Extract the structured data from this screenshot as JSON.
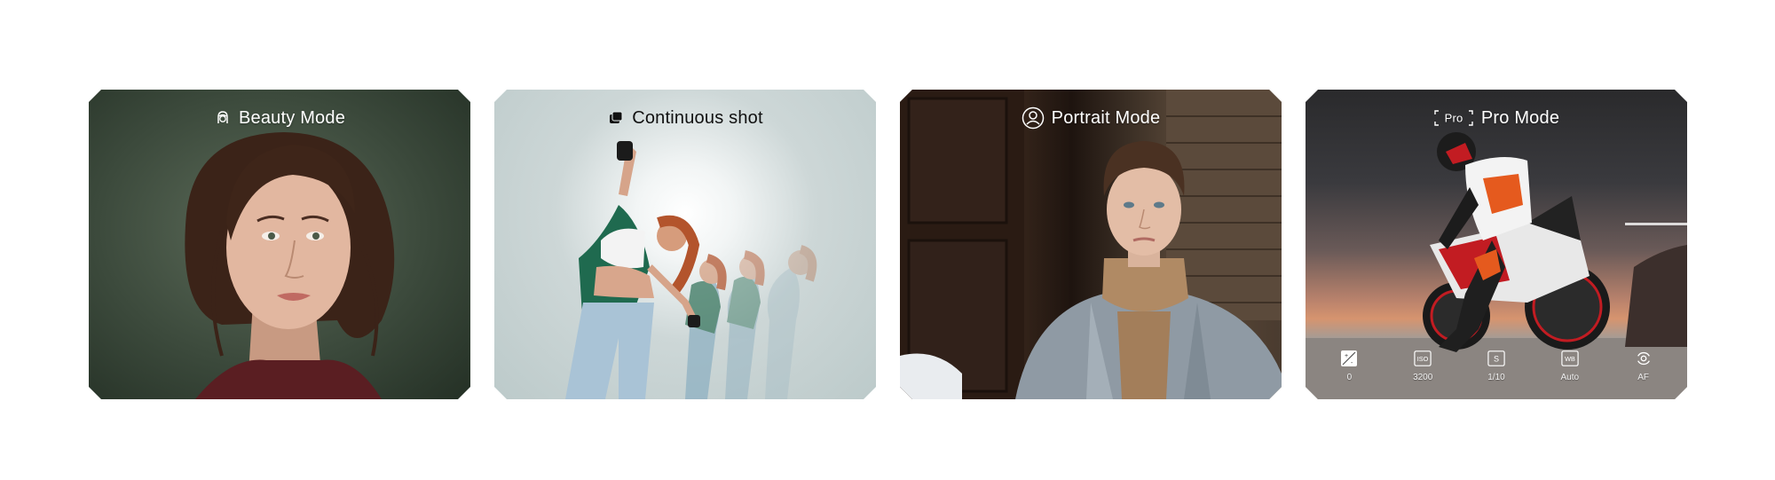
{
  "cards": [
    {
      "id": "beauty",
      "title": "Beauty Mode",
      "icon": "beauty-face-icon"
    },
    {
      "id": "continuous",
      "title": "Continuous shot",
      "icon": "stacked-frames-icon"
    },
    {
      "id": "portrait",
      "title": "Portrait Mode",
      "icon": "person-circle-icon"
    },
    {
      "id": "pro",
      "title": "Pro Mode",
      "icon_text": "Pro",
      "icon": "pro-bracket-icon"
    }
  ],
  "pro_controls": [
    {
      "label": "0",
      "icon": "exposure-icon"
    },
    {
      "label": "3200",
      "icon": "iso-icon",
      "icon_text": "ISO"
    },
    {
      "label": "1/10",
      "icon": "shutter-speed-icon",
      "icon_text": "S"
    },
    {
      "label": "Auto",
      "icon": "white-balance-icon",
      "icon_text": "WB"
    },
    {
      "label": "AF",
      "icon": "autofocus-icon"
    }
  ]
}
